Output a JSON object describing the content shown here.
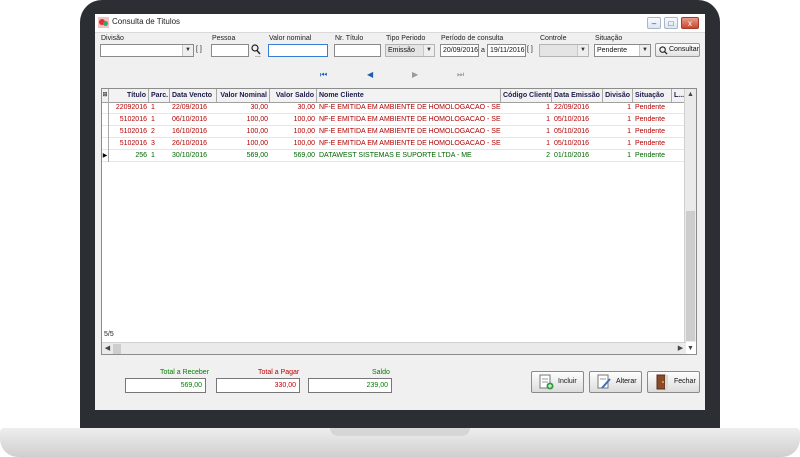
{
  "window": {
    "title": "Consulta de Titulos",
    "minimize": "–",
    "maximize": "□",
    "close": "x"
  },
  "filters": {
    "divisao_label": "Divisão",
    "divisao_value": "",
    "bracket": "[ ]",
    "pessoa_label": "Pessoa",
    "pessoa_value": "",
    "pessoa_dots": "...",
    "valor_label": "Valor nominal",
    "valor_value": "",
    "nr_label": "Nr. Título",
    "nr_value": "",
    "tipo_label": "Tipo Periodo",
    "tipo_value": "Emissão",
    "periodo_label": "Período de consulta",
    "date_from": "20/09/2016",
    "date_sep": "a",
    "date_to": "19/11/2016",
    "controle_label": "Controle",
    "controle_value": "",
    "situacao_label": "Situação",
    "situacao_value": "Pendente",
    "consultar": "Consultar"
  },
  "nav": {
    "first": "⏮",
    "prev": "◀",
    "next": "▶",
    "last": "⏭"
  },
  "grid": {
    "headers": [
      "Título",
      "Parc.",
      "Data Vencto",
      "Valor Nominal",
      "Valor Saldo",
      "Nome Cliente",
      "Código Cliente",
      "Data Emissão",
      "Divisão",
      "Situação",
      "L..."
    ],
    "rows": [
      {
        "titulo": "22092016",
        "parc": "1",
        "vencto": "22/09/2016",
        "nominal": "30,00",
        "saldo": "30,00",
        "cliente": "NF-E EMITIDA EM AMBIENTE DE HOMOLOGACAO - SEM VA",
        "codigo": "1",
        "emissao": "22/09/2016",
        "divisao": "1",
        "situacao": "Pendente",
        "color": "#b00000"
      },
      {
        "titulo": "5102016",
        "parc": "1",
        "vencto": "06/10/2016",
        "nominal": "100,00",
        "saldo": "100,00",
        "cliente": "NF-E EMITIDA EM AMBIENTE DE HOMOLOGACAO - SEM VA",
        "codigo": "1",
        "emissao": "05/10/2016",
        "divisao": "1",
        "situacao": "Pendente",
        "color": "#b00000"
      },
      {
        "titulo": "5102016",
        "parc": "2",
        "vencto": "16/10/2016",
        "nominal": "100,00",
        "saldo": "100,00",
        "cliente": "NF-E EMITIDA EM AMBIENTE DE HOMOLOGACAO - SEM VA",
        "codigo": "1",
        "emissao": "05/10/2016",
        "divisao": "1",
        "situacao": "Pendente",
        "color": "#b00000"
      },
      {
        "titulo": "5102016",
        "parc": "3",
        "vencto": "26/10/2016",
        "nominal": "100,00",
        "saldo": "100,00",
        "cliente": "NF-E EMITIDA EM AMBIENTE DE HOMOLOGACAO - SEM VA",
        "codigo": "1",
        "emissao": "05/10/2016",
        "divisao": "1",
        "situacao": "Pendente",
        "color": "#b00000"
      },
      {
        "titulo": "256",
        "parc": "1",
        "vencto": "30/10/2016",
        "nominal": "569,00",
        "saldo": "569,00",
        "cliente": "DATAWEST SISTEMAS E SUPORTE LTDA - ME",
        "codigo": "2",
        "emissao": "01/10/2016",
        "divisao": "1",
        "situacao": "Pendente",
        "color": "#006400"
      }
    ],
    "current_row_marker": "▶",
    "counter": "5/5"
  },
  "totals": {
    "receber_label": "Total a Receber",
    "receber_value": "569,00",
    "receber_color": "#008000",
    "pagar_label": "Total a Pagar",
    "pagar_value": "330,00",
    "pagar_color": "#c00000",
    "saldo_label": "Saldo",
    "saldo_value": "239,00",
    "saldo_color": "#008000"
  },
  "actions": {
    "incluir": "Incluir",
    "alterar": "Alterar",
    "fechar": "Fechar"
  }
}
